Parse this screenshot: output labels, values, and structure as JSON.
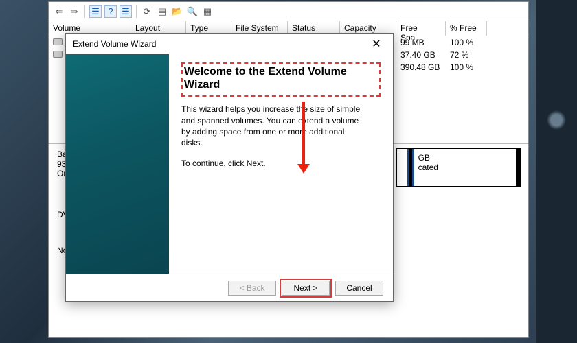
{
  "toolbar": {
    "icons": [
      "back",
      "forward",
      "row",
      "help",
      "row2",
      "refresh",
      "props",
      "open",
      "find",
      "settings"
    ]
  },
  "grid": {
    "headers": {
      "volume": "Volume",
      "layout": "Layout",
      "type": "Type",
      "fs": "File System",
      "status": "Status",
      "capacity": "Capacity",
      "free": "Free Spa...",
      "pfree": "% Free"
    },
    "rows": [
      {
        "vol": "",
        "free": "99 MB",
        "pfree": "100 %"
      },
      {
        "vol": "",
        "free": "37.40 GB",
        "pfree": "72 %"
      },
      {
        "vol": "",
        "free": "390.48 GB",
        "pfree": "100 %"
      }
    ]
  },
  "disk": {
    "label1": "Ba",
    "label2": "93",
    "label3": "On",
    "seg_size": "GB",
    "seg_state": "cated",
    "dv": "DV",
    "no": "No"
  },
  "wizard": {
    "title": "Extend Volume Wizard",
    "heading": "Welcome to the Extend Volume Wizard",
    "desc": "This wizard helps you increase the size of simple and spanned volumes. You can extend a volume  by adding space from one or more additional disks.",
    "continue": "To continue, click Next.",
    "back": "< Back",
    "next": "Next >",
    "cancel": "Cancel"
  }
}
